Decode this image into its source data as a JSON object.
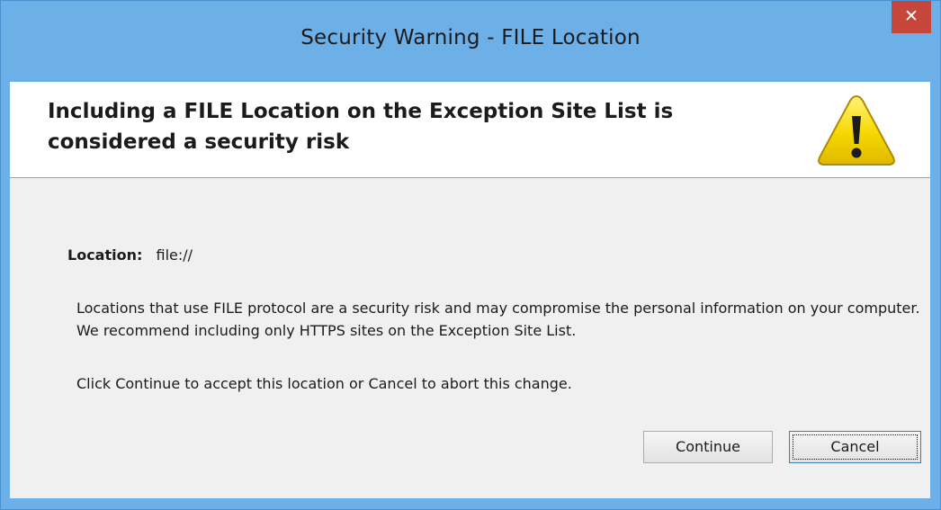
{
  "window": {
    "title": "Security Warning - FILE Location",
    "close_glyph": "✕"
  },
  "header": {
    "headline": "Including a FILE Location on the Exception Site List is considered a security risk",
    "icon": "warning-icon"
  },
  "content": {
    "location_label": "Location:",
    "location_value": "file://",
    "description": "Locations that use FILE protocol are a security risk and may compromise the personal information on your computer.  We recommend including only HTTPS sites on the Exception Site List.",
    "instruction": "Click Continue to accept this location or Cancel to abort this change."
  },
  "buttons": {
    "continue_label": "Continue",
    "cancel_label": "Cancel"
  },
  "colors": {
    "titlebar": "#6db0e8",
    "close_button": "#c7463b",
    "warning_yellow": "#f5d800",
    "content_background": "#f0f0f0"
  }
}
